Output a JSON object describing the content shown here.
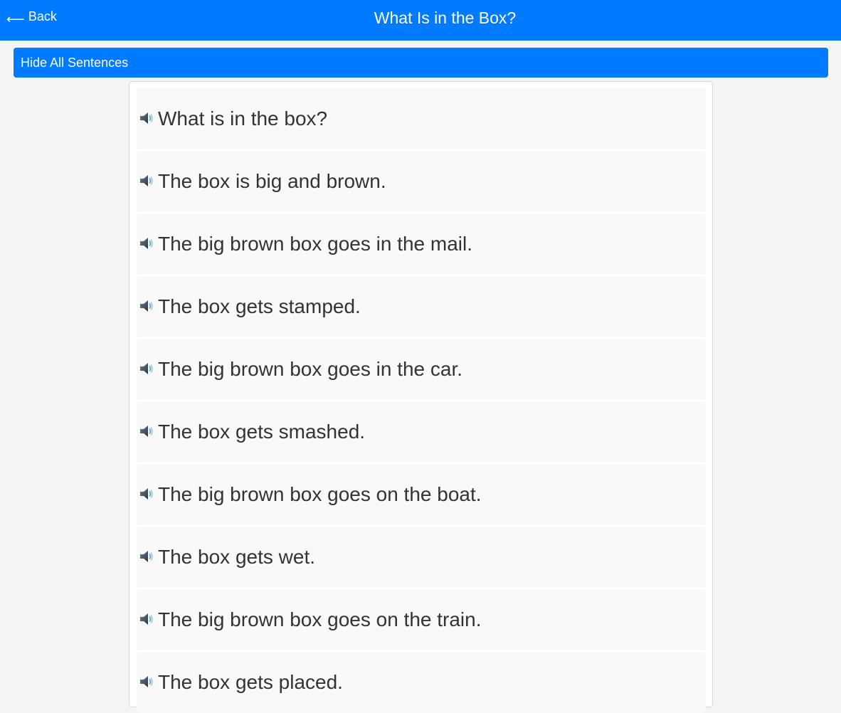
{
  "header": {
    "back_label": "Back",
    "back_icon": "arrow-left-icon",
    "title": "What Is in the Box?",
    "color": "#007bff"
  },
  "toolbar": {
    "hide_all_label": "Hide All Sentences"
  },
  "sentences": {
    "icon": "speaker-icon",
    "items": [
      "What is in the box?",
      "The box is big and brown.",
      "The big brown box goes in the mail.",
      "The box gets stamped.",
      "The big brown box goes in the car.",
      "The box gets smashed.",
      "The big brown box goes on the boat.",
      "The box gets wet.",
      "The big brown box goes on the train.",
      "The box gets placed."
    ]
  }
}
